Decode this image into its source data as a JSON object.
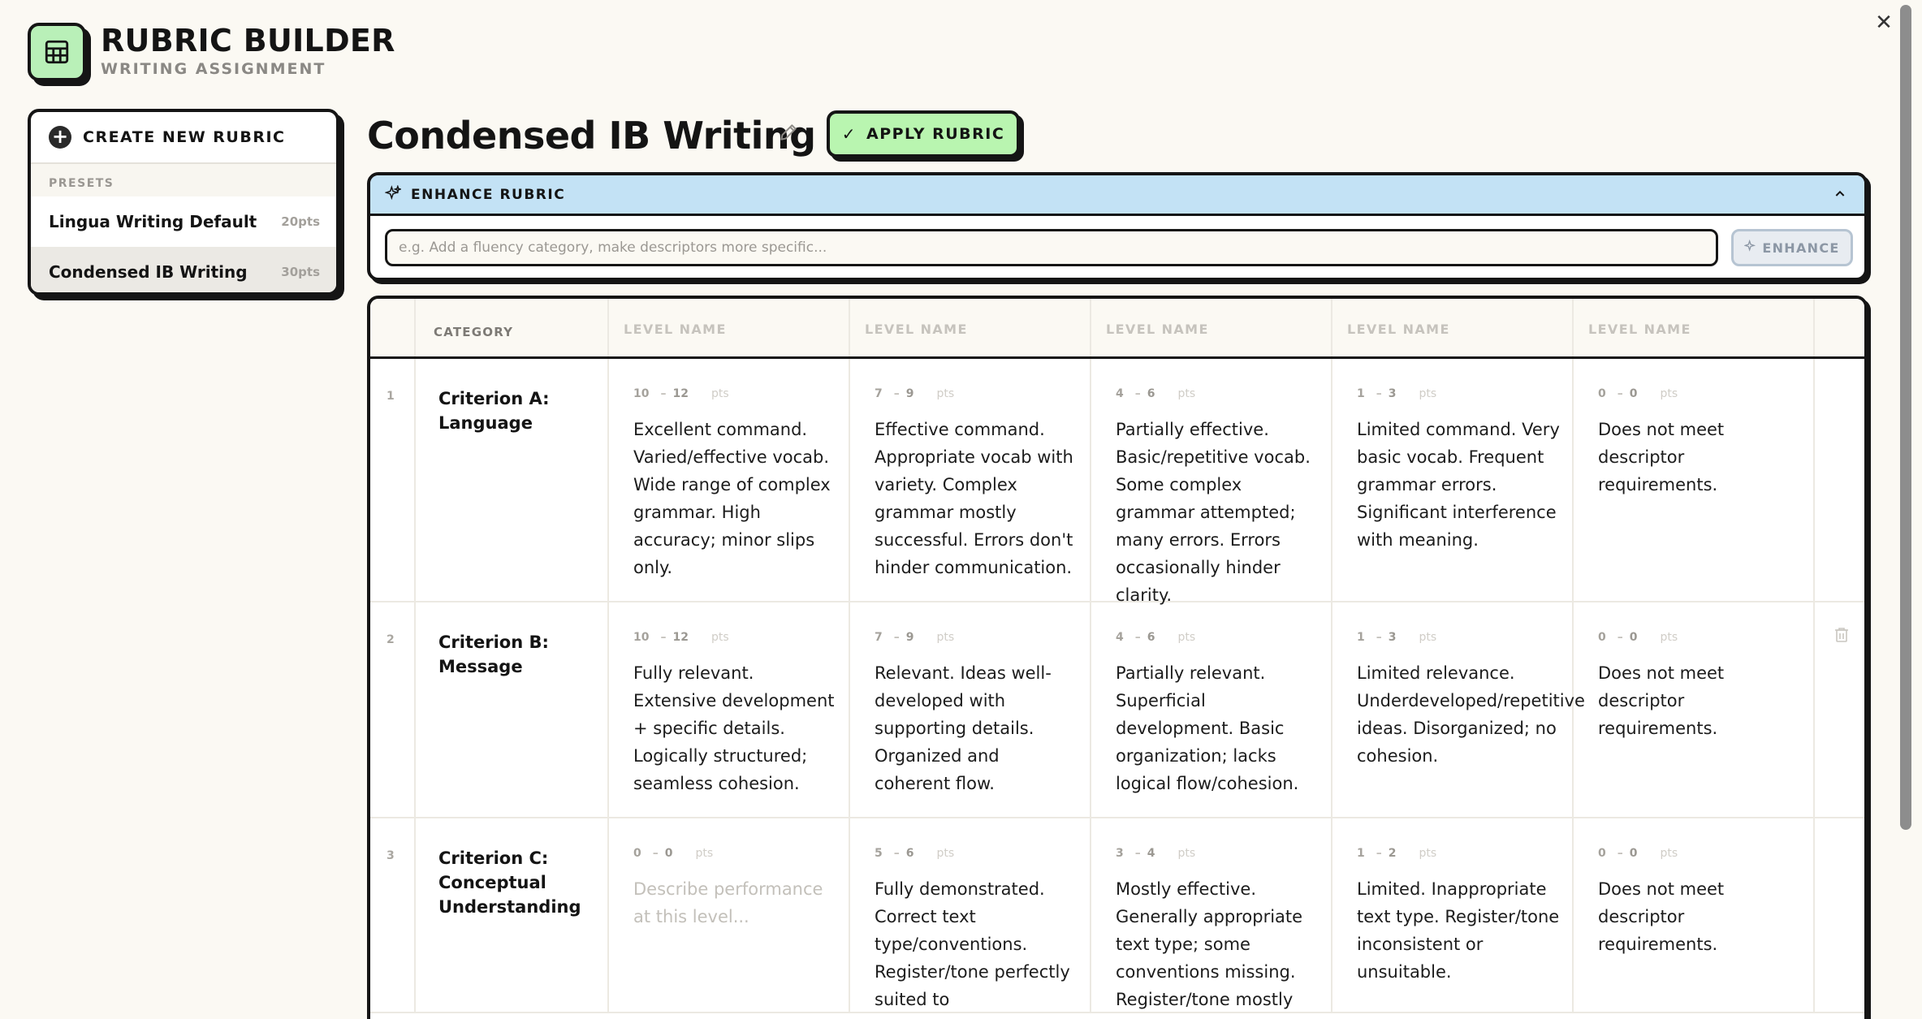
{
  "app": {
    "title": "RUBRIC BUILDER",
    "subtitle": "WRITING ASSIGNMENT",
    "logo_icon": "table-grid-icon"
  },
  "window": {
    "close_glyph": "✕"
  },
  "sidebar": {
    "create_label": "CREATE NEW RUBRIC",
    "presets_heading": "PRESETS",
    "presets": [
      {
        "name": "Lingua Writing Default",
        "pts": "20pts",
        "selected": false
      },
      {
        "name": "Condensed IB Writing",
        "pts": "30pts",
        "selected": true
      }
    ]
  },
  "main": {
    "title": "Condensed IB Writing",
    "apply_label": "APPLY RUBRIC",
    "enhance": {
      "heading": "ENHANCE RUBRIC",
      "placeholder": "e.g. Add a fluency category, make descriptors more specific...",
      "value": "",
      "button": "ENHANCE"
    }
  },
  "table": {
    "category_header": "CATEGORY",
    "level_headers": [
      "LEVEL NAME",
      "LEVEL NAME",
      "LEVEL NAME",
      "LEVEL NAME",
      "LEVEL NAME"
    ],
    "pts_unit": "pts",
    "dash": "–",
    "rows": [
      {
        "num": "1",
        "category": "Criterion A: Language",
        "levels": [
          {
            "min": "10",
            "max": "12",
            "desc": "Excellent command. Varied/effective vocab. Wide range of complex grammar. High accuracy; minor slips only."
          },
          {
            "min": "7",
            "max": "9",
            "desc": "Effective command. Appropriate vocab with variety. Complex grammar mostly successful. Errors don't hinder communication."
          },
          {
            "min": "4",
            "max": "6",
            "desc": "Partially effective. Basic/repetitive vocab. Some complex grammar attempted; many errors. Errors occasionally hinder clarity."
          },
          {
            "min": "1",
            "max": "3",
            "desc": "Limited command. Very basic vocab. Frequent grammar errors. Significant interference with meaning."
          },
          {
            "min": "0",
            "max": "0",
            "desc": "Does not meet descriptor requirements."
          }
        ]
      },
      {
        "num": "2",
        "category": "Criterion B: Message",
        "levels": [
          {
            "min": "10",
            "max": "12",
            "desc": "Fully relevant. Extensive development + specific details. Logically structured; seamless cohesion."
          },
          {
            "min": "7",
            "max": "9",
            "desc": "Relevant. Ideas well-developed with supporting details. Organized and coherent flow."
          },
          {
            "min": "4",
            "max": "6",
            "desc": "Partially relevant. Superficial development. Basic organization; lacks logical flow/cohesion."
          },
          {
            "min": "1",
            "max": "3",
            "desc": "Limited relevance. Underdeveloped/repetitive ideas. Disorganized; no cohesion."
          },
          {
            "min": "0",
            "max": "0",
            "desc": "Does not meet descriptor requirements."
          }
        ]
      },
      {
        "num": "3",
        "category": "Criterion C: Conceptual Understanding",
        "levels": [
          {
            "min": "0",
            "max": "0",
            "desc": "",
            "placeholder": "Describe performance at this level..."
          },
          {
            "min": "5",
            "max": "6",
            "desc": "Fully demonstrated. Correct text type/conventions. Register/tone perfectly suited to"
          },
          {
            "min": "3",
            "max": "4",
            "desc": "Mostly effective. Generally appropriate text type; some conventions missing. Register/tone mostly"
          },
          {
            "min": "1",
            "max": "2",
            "desc": "Limited. Inappropriate text type. Register/tone inconsistent or unsuitable."
          },
          {
            "min": "0",
            "max": "0",
            "desc": "Does not meet descriptor requirements."
          }
        ]
      }
    ]
  }
}
